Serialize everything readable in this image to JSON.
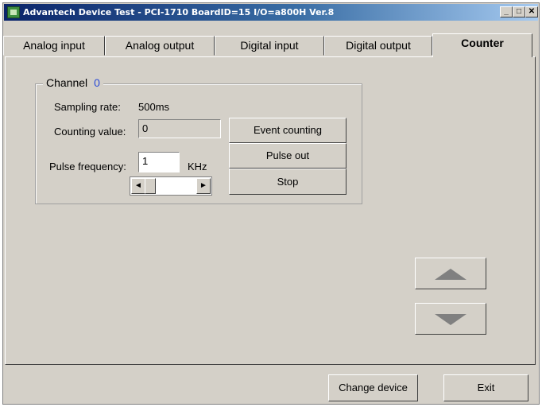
{
  "window": {
    "title": "Advantech Device Test - PCI-1710 BoardID=15 I/O=a800H Ver.8",
    "minimize_glyph": "_",
    "maximize_glyph": "□",
    "close_glyph": "✕"
  },
  "tabs": [
    {
      "label": "Analog input"
    },
    {
      "label": "Analog output"
    },
    {
      "label": "Digital input"
    },
    {
      "label": "Digital output"
    },
    {
      "label": "Counter"
    }
  ],
  "counter": {
    "group_label": "Channel",
    "channel_value": "0",
    "sampling_rate_label": "Sampling rate:",
    "sampling_rate_value": "500ms",
    "counting_value_label": "Counting value:",
    "counting_value": "0",
    "pulse_frequency_label": "Pulse frequency:",
    "pulse_frequency_value": "1",
    "pulse_unit": "KHz",
    "event_counting_button": "Event counting",
    "pulse_out_button": "Pulse out",
    "stop_button": "Stop"
  },
  "footer": {
    "change_device_button": "Change device",
    "exit_button": "Exit"
  },
  "icons": {
    "app": "advantech-app-icon",
    "scroll_left": "◄",
    "scroll_right": "►",
    "up": "up-arrow-icon",
    "down": "down-arrow-icon"
  }
}
